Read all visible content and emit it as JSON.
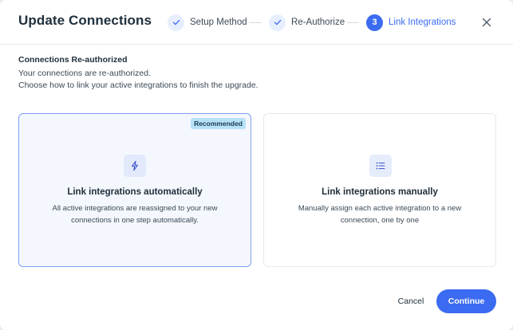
{
  "dialog": {
    "title": "Update Connections",
    "close_icon": "close-icon"
  },
  "stepper": {
    "steps": [
      {
        "label": "Setup Method",
        "status": "done",
        "icon": "check-icon"
      },
      {
        "label": "Re-Authorize",
        "status": "done",
        "icon": "check-icon"
      },
      {
        "label": "Link Integrations",
        "status": "active",
        "number": "3"
      }
    ]
  },
  "content": {
    "section_title": "Connections Re-authorized",
    "line1": "Your connections are re-authorized.",
    "line2": "Choose how to link your active integrations to finish the upgrade."
  },
  "options": [
    {
      "badge": "Recommended",
      "icon": "lightning-icon",
      "title": "Link integrations automatically",
      "description": "All active integrations are reassigned to your new connections in one step automatically.",
      "selected": true
    },
    {
      "icon": "list-icon",
      "title": "Link integrations manually",
      "description": "Manually assign each active integration to a new connection, one by one",
      "selected": false
    }
  ],
  "footer": {
    "cancel_label": "Cancel",
    "continue_label": "Continue"
  },
  "colors": {
    "accent": "#3b6bf0",
    "badge": "#b7e1f7",
    "selected_card_bg": "#f4f7fd",
    "selected_card_border": "#7f9ff0"
  }
}
